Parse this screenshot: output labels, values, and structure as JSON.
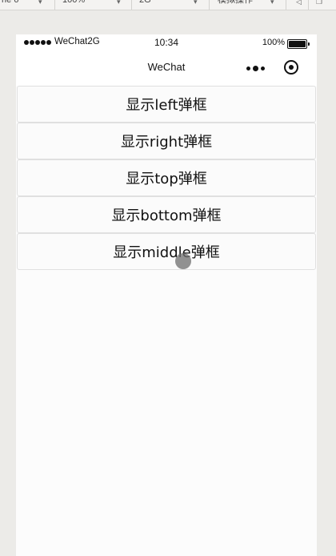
{
  "devtools": {
    "items": [
      {
        "label": "ne 6"
      },
      {
        "label": "100%"
      },
      {
        "label": "2G"
      },
      {
        "label": "模拟操作"
      }
    ]
  },
  "statusbar": {
    "carrier": "WeChat2G",
    "time": "10:34",
    "battery": "100%",
    "signal_bars": 5
  },
  "navbar": {
    "title": "WeChat",
    "more_icon": "more-dots-icon",
    "close_icon": "capsule-close-icon"
  },
  "buttons": [
    {
      "label": "显示left弹框"
    },
    {
      "label": "显示right弹框"
    },
    {
      "label": "显示top弹框"
    },
    {
      "label": "显示bottom弹框"
    },
    {
      "label": "显示middle弹框"
    }
  ],
  "colors": {
    "background": "#ecebe8",
    "page": "#fcfcfc",
    "button_border": "#e0e0e0",
    "text": "#111111"
  }
}
